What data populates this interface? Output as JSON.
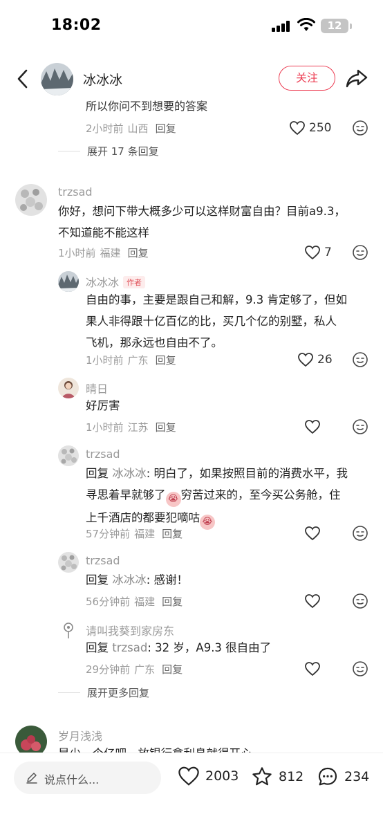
{
  "status_bar": {
    "time": "18:02",
    "battery": "12"
  },
  "nav": {
    "username": "冰冰冰",
    "follow_label": "关注"
  },
  "comments": {
    "clipped_text": "所以你问不到想要的答案",
    "top_comment_meta": {
      "time": "2小时前",
      "location": "山西",
      "reply": "回复",
      "likes": "250"
    },
    "expand_17": "展开 17 条回复",
    "main_comment": {
      "username": "trzsad",
      "text_line1": "你好，想问下带大概多少可以这样财富自由？目前a9.3，",
      "text_line2": "不知道能不能这样",
      "time": "1小时前",
      "location": "福建",
      "reply": "回复",
      "likes": "7"
    },
    "replies": [
      {
        "username": "冰冰冰",
        "tag": "作者",
        "text_line1": "自由的事，主要是跟自己和解，9.3 肯定够了，但如",
        "text_line2": "果人非得跟十亿百亿的比，买几个亿的别墅，私人",
        "text_line3": "飞机，那永远也自由不了。",
        "time": "1小时前",
        "location": "广东",
        "reply": "回复",
        "likes": "26"
      },
      {
        "username": "晴日",
        "text_line1": "好厉害",
        "time": "1小时前",
        "location": "江苏",
        "reply": "回复"
      },
      {
        "username": "trzsad",
        "reply_prefix": "回复 ",
        "mention": "冰冰冰",
        "text_line1_rest": ": 明白了，如果按照目前的消费水平，我",
        "text_line2_a": "寻思着早就够了",
        "text_line2_b": "穷苦过来的，至今买公务舱，住",
        "text_line3": "上千酒店的都要犯嘀咕",
        "time": "57分钟前",
        "location": "福建",
        "reply": "回复"
      },
      {
        "username": "trzsad",
        "reply_prefix": "回复 ",
        "mention": "冰冰冰",
        "text_rest": ": 感谢！",
        "time": "56分钟前",
        "location": "福建",
        "reply": "回复"
      },
      {
        "username": "请叫我葵到家房东",
        "reply_prefix": "回复 ",
        "mention": "trzsad",
        "text_rest": ": 32 岁，A9.3 很自由了",
        "time": "29分钟前",
        "location": "广东",
        "reply": "回复"
      }
    ],
    "expand_more": "展开更多回复",
    "next_comment": {
      "username": "岁月浅浅",
      "text_clipped": "是少一个亿吧，放银行拿利息就得开心"
    }
  },
  "bottom_bar": {
    "input_placeholder": "说点什么...",
    "likes": "2003",
    "favorites": "812",
    "comments": "234"
  },
  "colors": {
    "accent": "#ec3c52",
    "meta_gray": "#9a9a9a"
  },
  "icons": [
    "back-icon",
    "share-icon",
    "heart-icon",
    "emoji-icon",
    "pencil-icon",
    "star-icon",
    "comment-bubble-icon",
    "signal-icon",
    "wifi-icon",
    "battery-icon"
  ]
}
